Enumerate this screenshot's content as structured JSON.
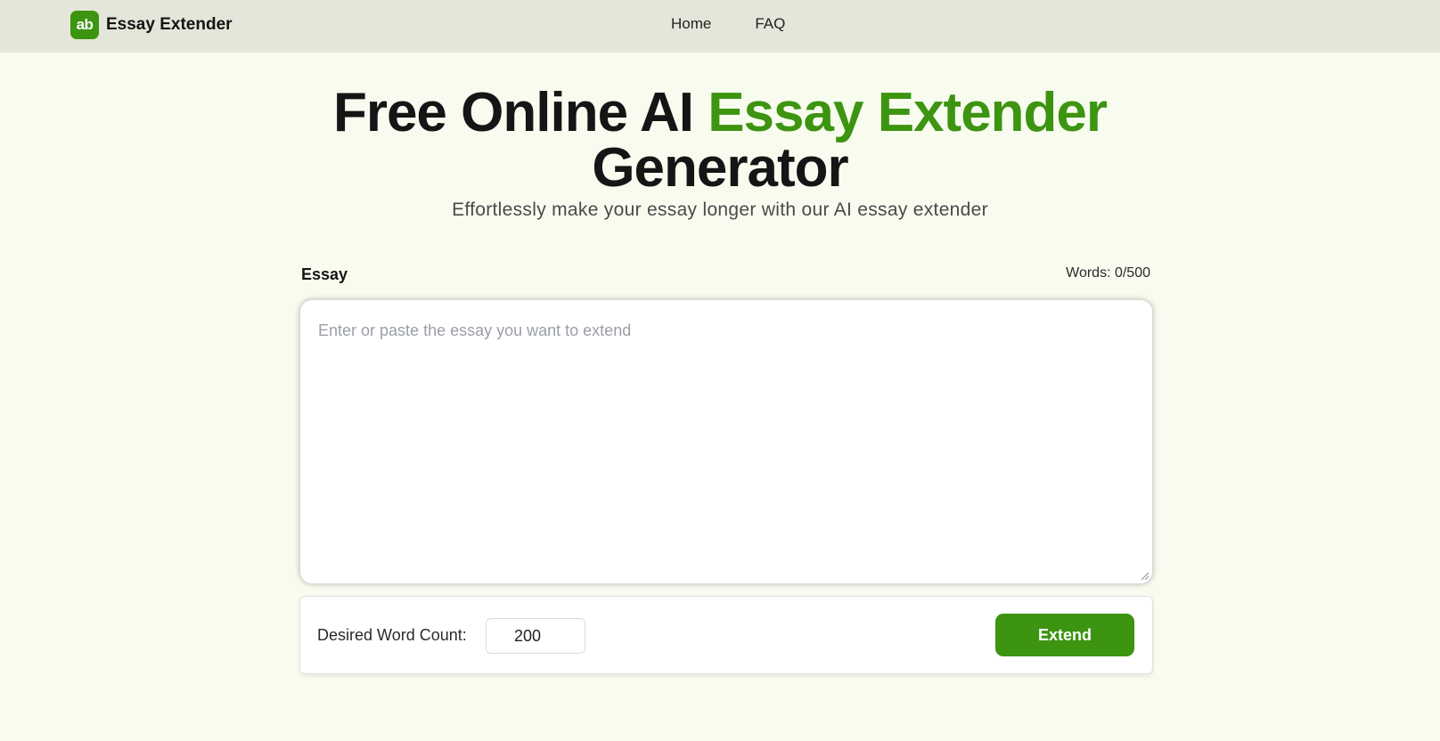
{
  "brand": {
    "logo_glyph": "ab",
    "name": "Essay Extender",
    "accent_color": "#3c9410"
  },
  "nav": {
    "items": [
      {
        "label": "Home"
      },
      {
        "label": "FAQ"
      }
    ]
  },
  "hero": {
    "title_prefix": "Free Online AI ",
    "title_accent": "Essay Extender",
    "title_suffix": "Generator",
    "subtitle": "Effortlessly make your essay longer with our AI essay extender"
  },
  "essay": {
    "label": "Essay",
    "word_counter": "Words: 0/500",
    "placeholder": "Enter or paste the essay you want to extend",
    "value": ""
  },
  "controls": {
    "word_count_label": "Desired Word Count:",
    "word_count_value": "200",
    "extend_label": "Extend"
  }
}
